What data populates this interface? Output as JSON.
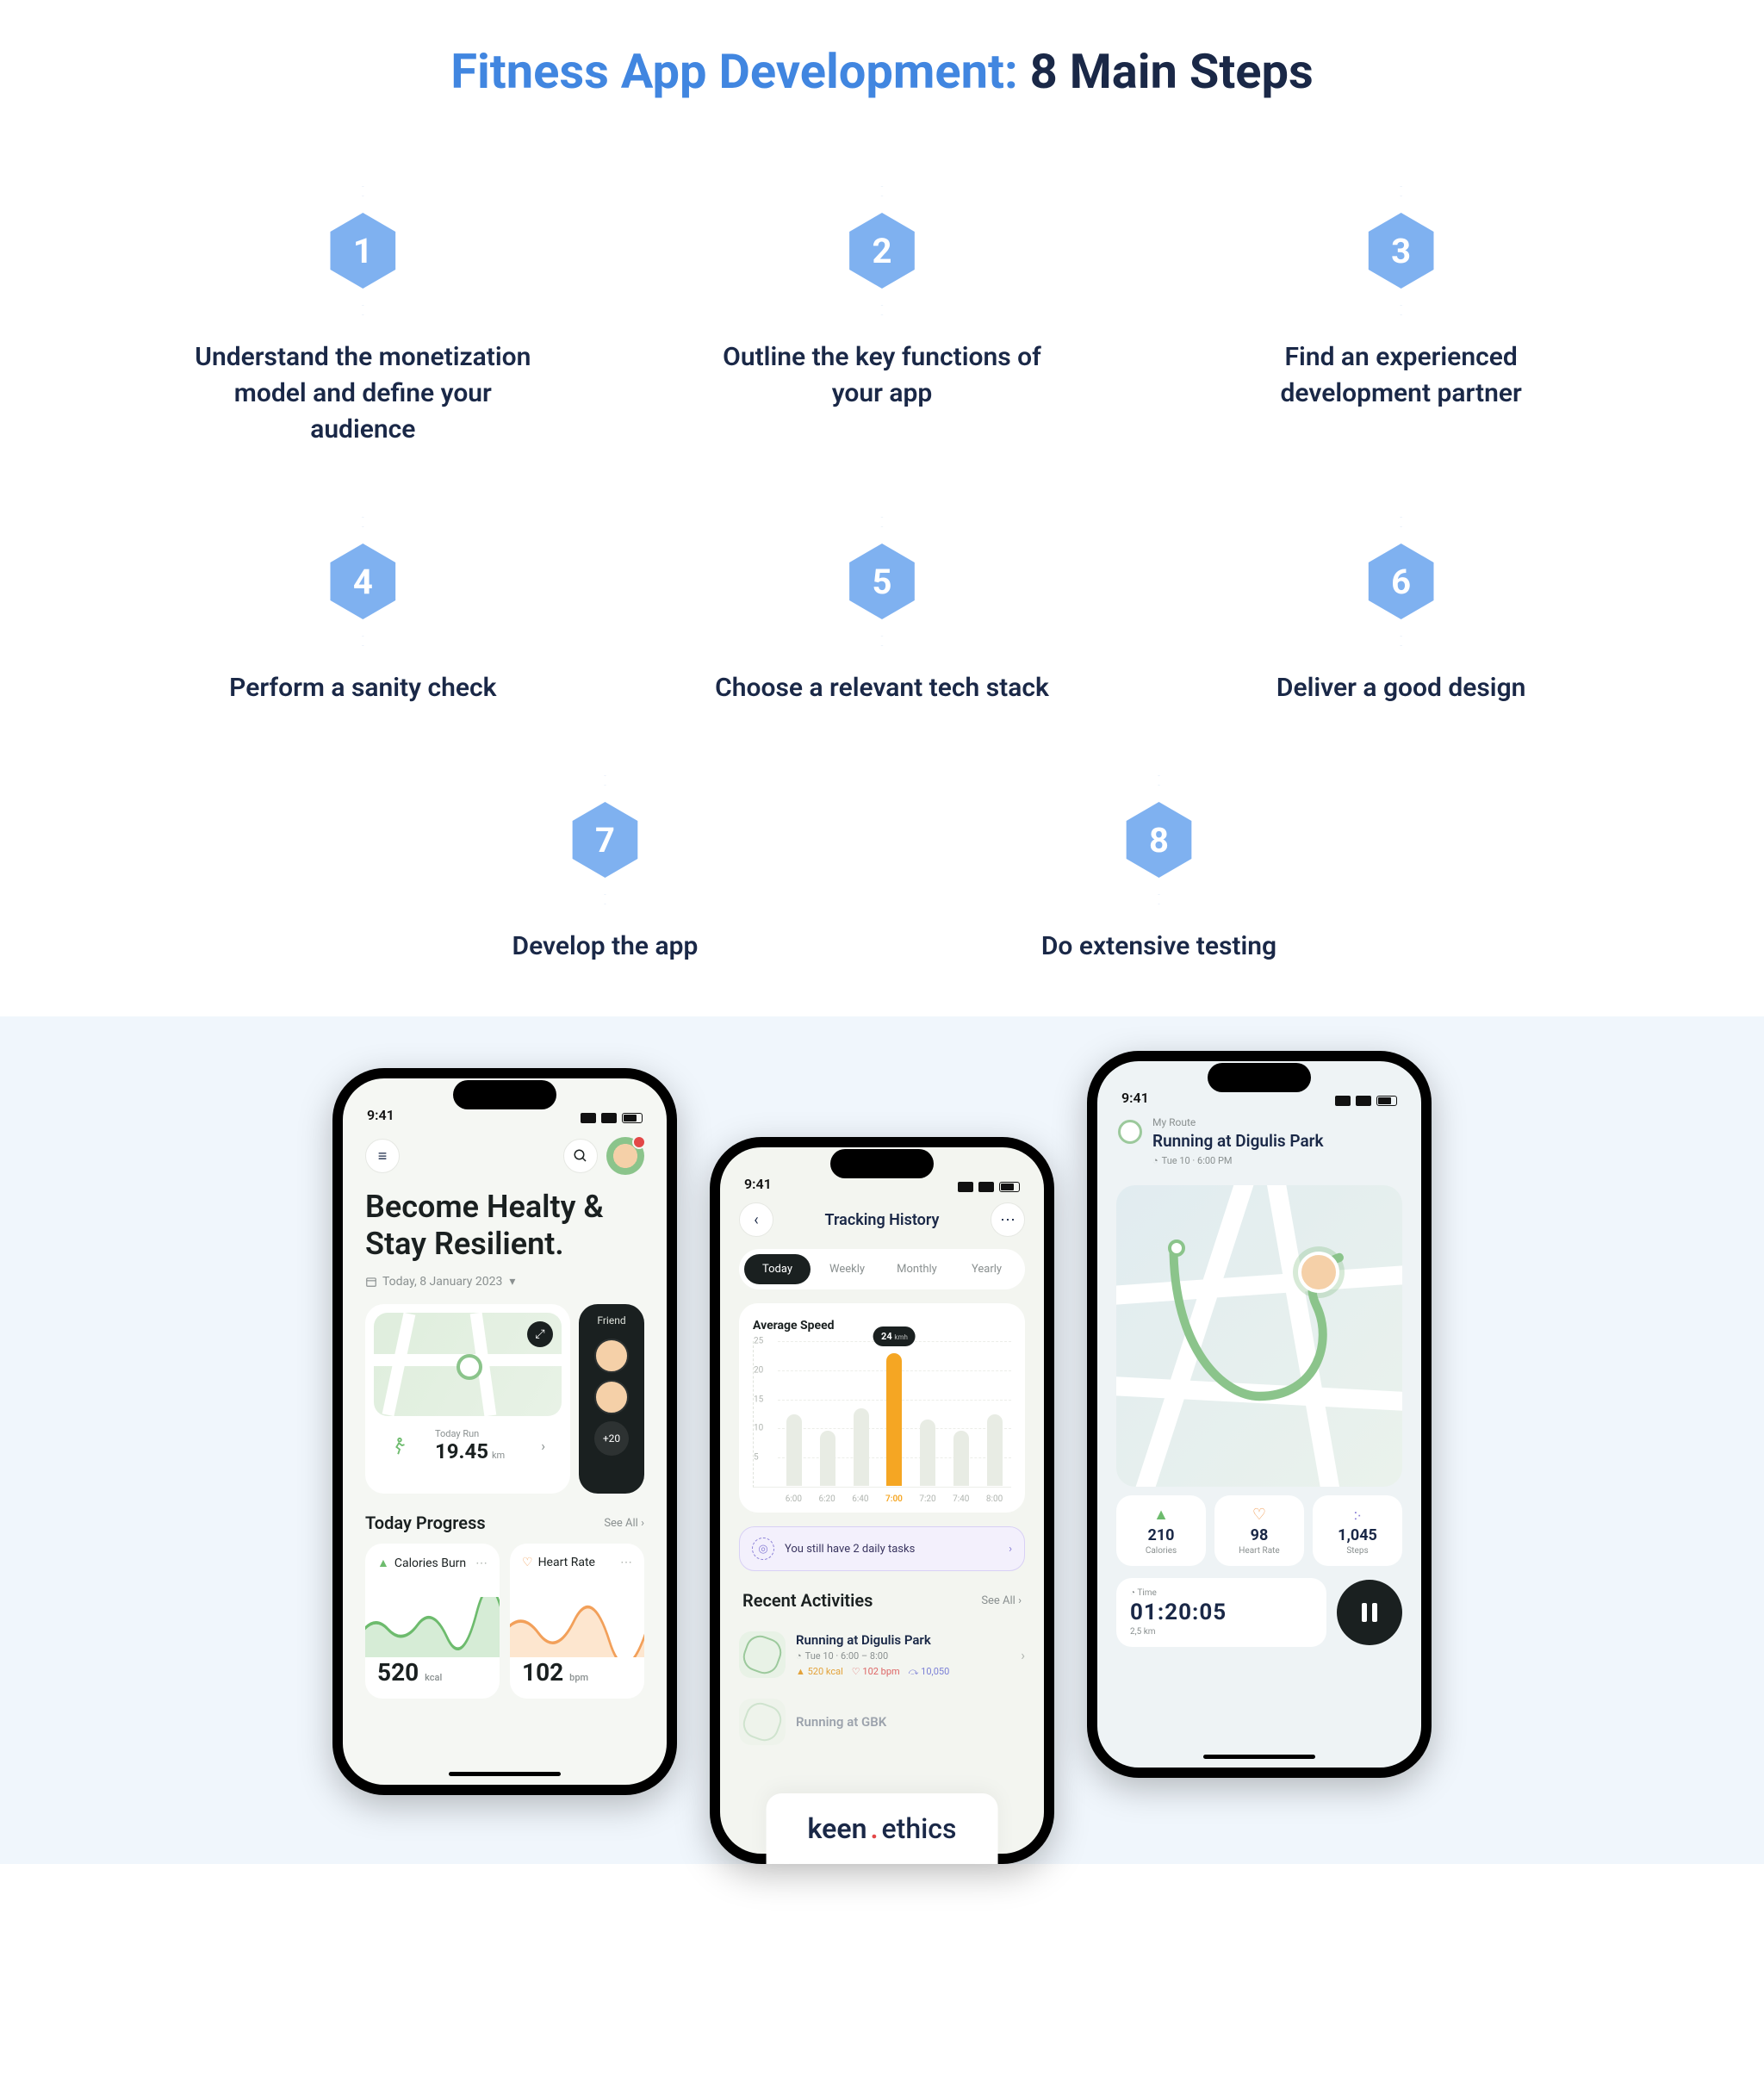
{
  "title": {
    "accent": "Fitness App Development:",
    "main": " 8 Main Steps"
  },
  "steps": [
    {
      "n": "1",
      "label": "Understand the monetization model and define your audience"
    },
    {
      "n": "2",
      "label": "Outline the key functions of your app"
    },
    {
      "n": "3",
      "label": "Find an experienced development partner"
    },
    {
      "n": "4",
      "label": "Perform a sanity check"
    },
    {
      "n": "5",
      "label": "Choose a relevant tech stack"
    },
    {
      "n": "6",
      "label": "Deliver a good design"
    },
    {
      "n": "7",
      "label": "Develop the app"
    },
    {
      "n": "8",
      "label": "Do extensive testing"
    }
  ],
  "brand": {
    "keen": "keen",
    "dot": ".",
    "ethics": "ethics"
  },
  "phone1": {
    "time": "9:41",
    "headline1": "Become Healty &",
    "headline2": "Stay Resilient.",
    "date": "Today, 8 January 2023",
    "map": {
      "label": "Today Run",
      "value": "19.45",
      "unit": "km"
    },
    "friends": {
      "title": "Friend",
      "more": "+20"
    },
    "section": "Today Progress",
    "seeall": "See All",
    "cards": {
      "cal": {
        "title": "Calories Burn",
        "value": "520",
        "unit": "kcal"
      },
      "hr": {
        "title": "Heart Rate",
        "value": "102",
        "unit": "bpm"
      }
    }
  },
  "phone2": {
    "time": "9:41",
    "title": "Tracking History",
    "tabs": [
      "Today",
      "Weekly",
      "Monthly",
      "Yearly"
    ],
    "chartTitle": "Average Speed",
    "tooltip": {
      "value": "24",
      "unit": "kmh"
    },
    "section": "Recent Activities",
    "seeall": "See All",
    "banner": "You still have 2 daily tasks",
    "activities": [
      {
        "title": "Running at Digulis Park",
        "sub": "Tue 10 · 6:00 – 8:00",
        "kcal": "520 kcal",
        "bpm": "102 bpm",
        "steps": "10,050"
      },
      {
        "title": "Running at GBK"
      }
    ]
  },
  "phone3": {
    "time": "9:41",
    "small": "My Route",
    "title": "Running at Digulis Park",
    "date": "Tue 10 · 6:00 PM",
    "metrics": {
      "cal": {
        "value": "210",
        "label": "Calories"
      },
      "hr": {
        "value": "98",
        "label": "Heart Rate"
      },
      "st": {
        "value": "1,045",
        "label": "Steps"
      }
    },
    "timer": {
      "label": "Time",
      "value": "01:20:05",
      "dist": "2,5 km"
    }
  },
  "chart_data": {
    "type": "bar",
    "title": "Average Speed",
    "ylabel": "kmh",
    "ylim": [
      0,
      25
    ],
    "yticks": [
      5,
      10,
      15,
      20,
      25
    ],
    "categories": [
      "6:00",
      "6:20",
      "6:40",
      "7:00",
      "7:20",
      "7:40",
      "8:00"
    ],
    "values": [
      13,
      10,
      14,
      24,
      12,
      10,
      13
    ],
    "highlight_index": 3,
    "highlight_label": "24 kmh"
  }
}
